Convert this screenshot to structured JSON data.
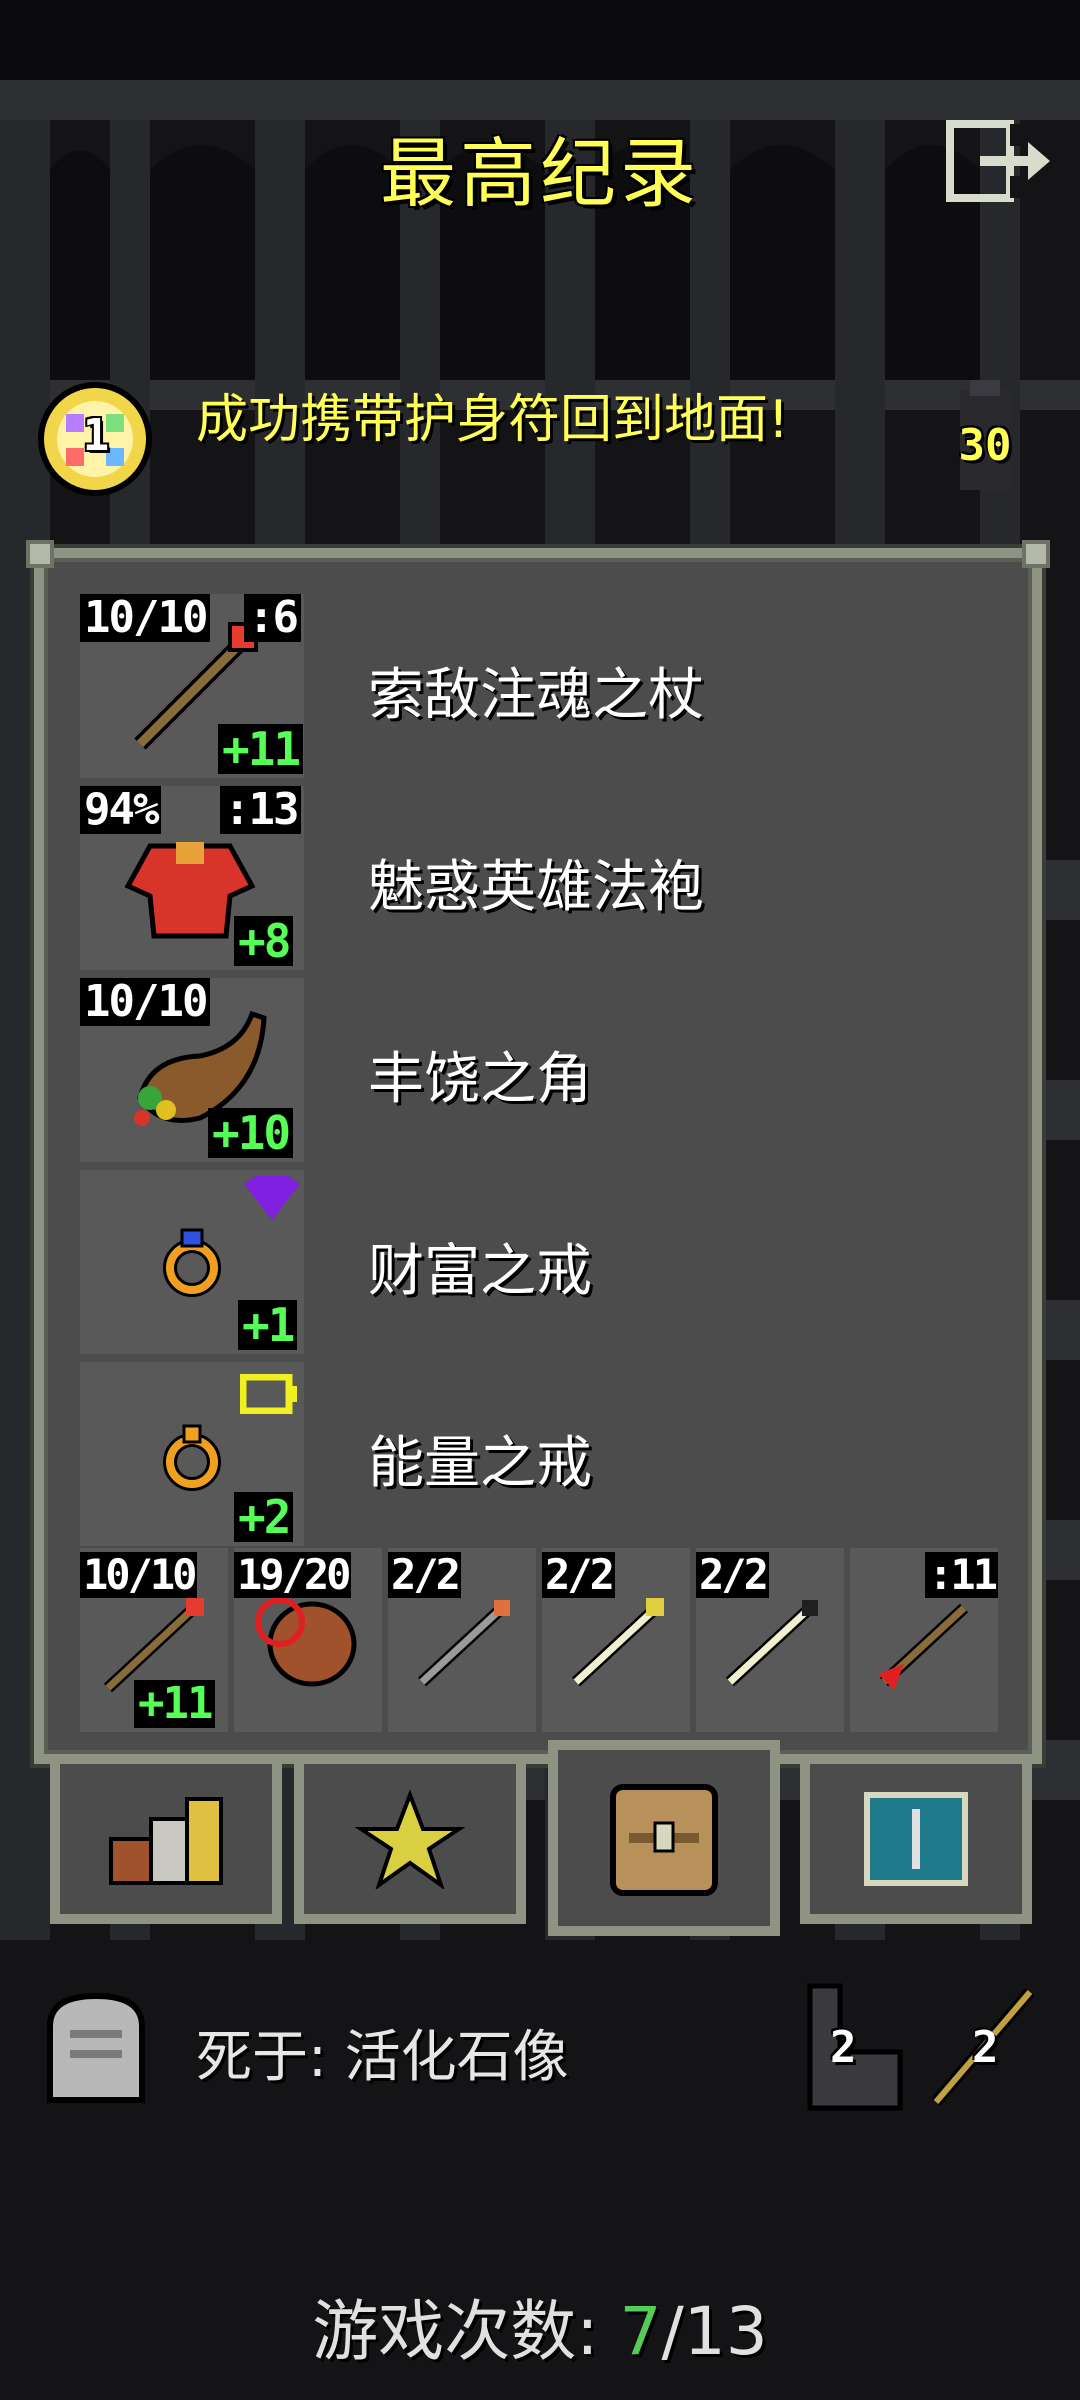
{
  "header": {
    "title": "最高纪录",
    "exit_icon": "exit-door-icon"
  },
  "result": {
    "badge_count": "1",
    "text": "成功携带护身符回到地面!",
    "depth": "30"
  },
  "items": [
    {
      "name": "索敌注魂之杖",
      "charges": "10/10",
      "quantity": ":6",
      "upgrade": "+11",
      "icon": "wand-icon"
    },
    {
      "name": "魅惑英雄法袍",
      "durability": "94%",
      "strength": ":13",
      "upgrade": "+8",
      "icon": "robe-icon"
    },
    {
      "name": "丰饶之角",
      "charges": "10/10",
      "upgrade": "+10",
      "icon": "horn-of-plenty-icon"
    },
    {
      "name": "财富之戒",
      "upgrade": "+1",
      "icon": "ring-icon",
      "status_icon": "purple-gem-icon"
    },
    {
      "name": "能量之戒",
      "upgrade": "+2",
      "icon": "ring-icon",
      "status_icon": "yellow-battery-icon"
    }
  ],
  "quickslots": [
    {
      "badge": "10/10",
      "upgrade": "+11",
      "icon": "wand-icon"
    },
    {
      "badge": "19/20",
      "icon": "waterskin-icon"
    },
    {
      "badge": "2/2",
      "icon": "wand-icon"
    },
    {
      "badge": "2/2",
      "icon": "wand-icon"
    },
    {
      "badge": "2/2",
      "icon": "wand-icon"
    },
    {
      "badge": ":11",
      "icon": "throwing-dart-icon"
    }
  ],
  "tabs": [
    {
      "icon": "stats-icon",
      "active": false
    },
    {
      "icon": "badges-star-icon",
      "active": false
    },
    {
      "icon": "backpack-icon",
      "active": true
    },
    {
      "icon": "journal-icon",
      "active": false
    }
  ],
  "footer": {
    "death_text": "死于: 活化石像",
    "stat_1": "2",
    "stat_2": "2",
    "games_label": "游戏次数:",
    "games_current": "7",
    "games_total": "/13"
  }
}
